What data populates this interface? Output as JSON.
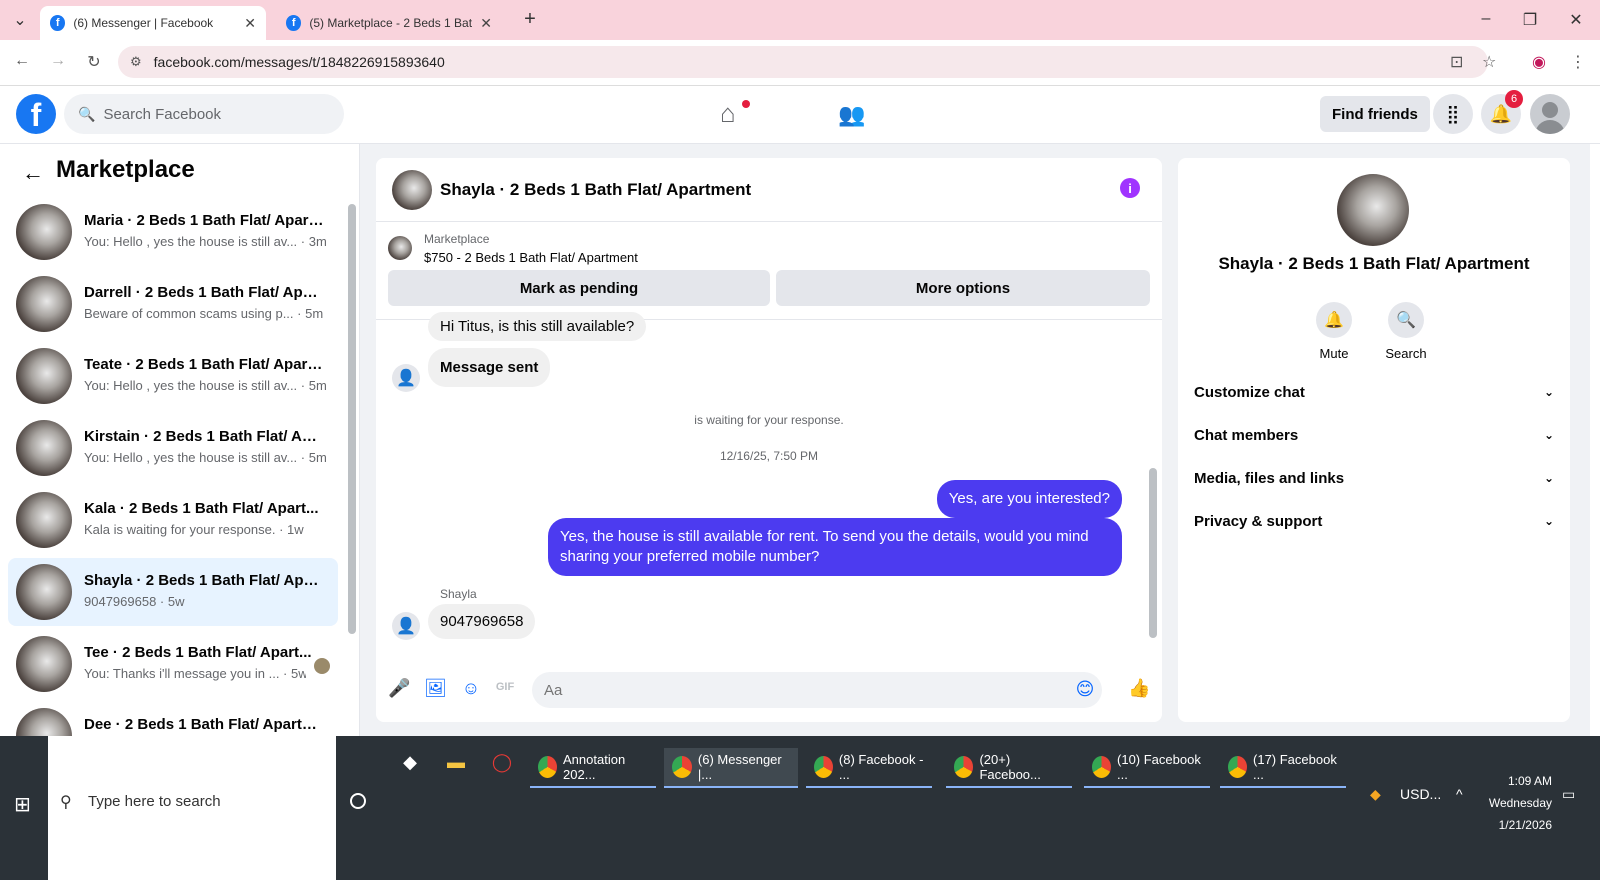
{
  "browser": {
    "tabs": [
      {
        "favicon": "f",
        "title": "(6) Messenger | Facebook"
      },
      {
        "favicon": "f",
        "title": "(5) Marketplace - 2 Beds 1 Bath"
      }
    ],
    "url": "facebook.com/messages/t/1848226915893640"
  },
  "header": {
    "search_placeholder": "Search Facebook",
    "find_friends": "Find friends",
    "notifications_count": "6"
  },
  "sidebar": {
    "title": "Marketplace",
    "conversations": [
      {
        "name": "Maria · 2 Beds 1 Bath Flat/ Apart...",
        "preview": "You: Hello , yes the house is still av... · 3m"
      },
      {
        "name": "Darrell · 2 Beds 1 Bath Flat/ Apar...",
        "preview": "Beware of common scams using p... · 5m"
      },
      {
        "name": "Teate · 2 Beds 1 Bath Flat/ Apart...",
        "preview": "You: Hello , yes the house is still av... · 5m"
      },
      {
        "name": "Kirstain · 2 Beds 1 Bath Flat/ Apa...",
        "preview": "You: Hello , yes the house is still av... · 5m"
      },
      {
        "name": "Kala · 2 Beds 1 Bath Flat/ Apart...",
        "preview": "Kala is waiting for your response. · 1w"
      },
      {
        "name": "Shayla · 2 Beds 1 Bath Flat/ Apar...",
        "preview": "9047969658 · 5w"
      },
      {
        "name": "Tee · 2 Beds 1 Bath Flat/ Apart...",
        "preview": "You: Thanks i'll message you in ... · 5w"
      },
      {
        "name": "Dee · 2 Beds 1 Bath Flat/ Apartm...",
        "preview": ""
      }
    ]
  },
  "chat": {
    "title": "Shayla · 2 Beds 1 Bath Flat/ Apartment",
    "marketplace_label": "Marketplace",
    "listing": "$750 - 2 Beds 1 Bath Flat/ Apartment",
    "mark_pending": "Mark as pending",
    "more_options": "More options",
    "messages": {
      "in1": "Hi Titus, is this still available?",
      "in2": "Message sent",
      "sys_wait": "is waiting for your response.",
      "timestamp": "12/16/25, 7:50 PM",
      "out1": "Yes, are you interested?",
      "out2": "Yes, the house is still available for rent. To send you the details, would you mind sharing your preferred mobile number?",
      "sender": "Shayla",
      "in3": "9047969658"
    },
    "composer_placeholder": "Aa"
  },
  "info": {
    "name": "Shayla · 2 Beds 1 Bath Flat/ Apartment",
    "mute": "Mute",
    "search": "Search",
    "rows": [
      "Customize chat",
      "Chat members",
      "Media, files and links",
      "Privacy & support"
    ]
  },
  "taskbar": {
    "search_placeholder": "Type here to search",
    "apps": [
      "Annotation 202...",
      "(6) Messenger |...",
      "(8) Facebook - ...",
      "(20+) Faceboo...",
      "(10) Facebook ...",
      "(17) Facebook ..."
    ],
    "currency": "USD...",
    "time": "1:09 AM",
    "day": "Wednesday",
    "date": "1/21/2026"
  }
}
